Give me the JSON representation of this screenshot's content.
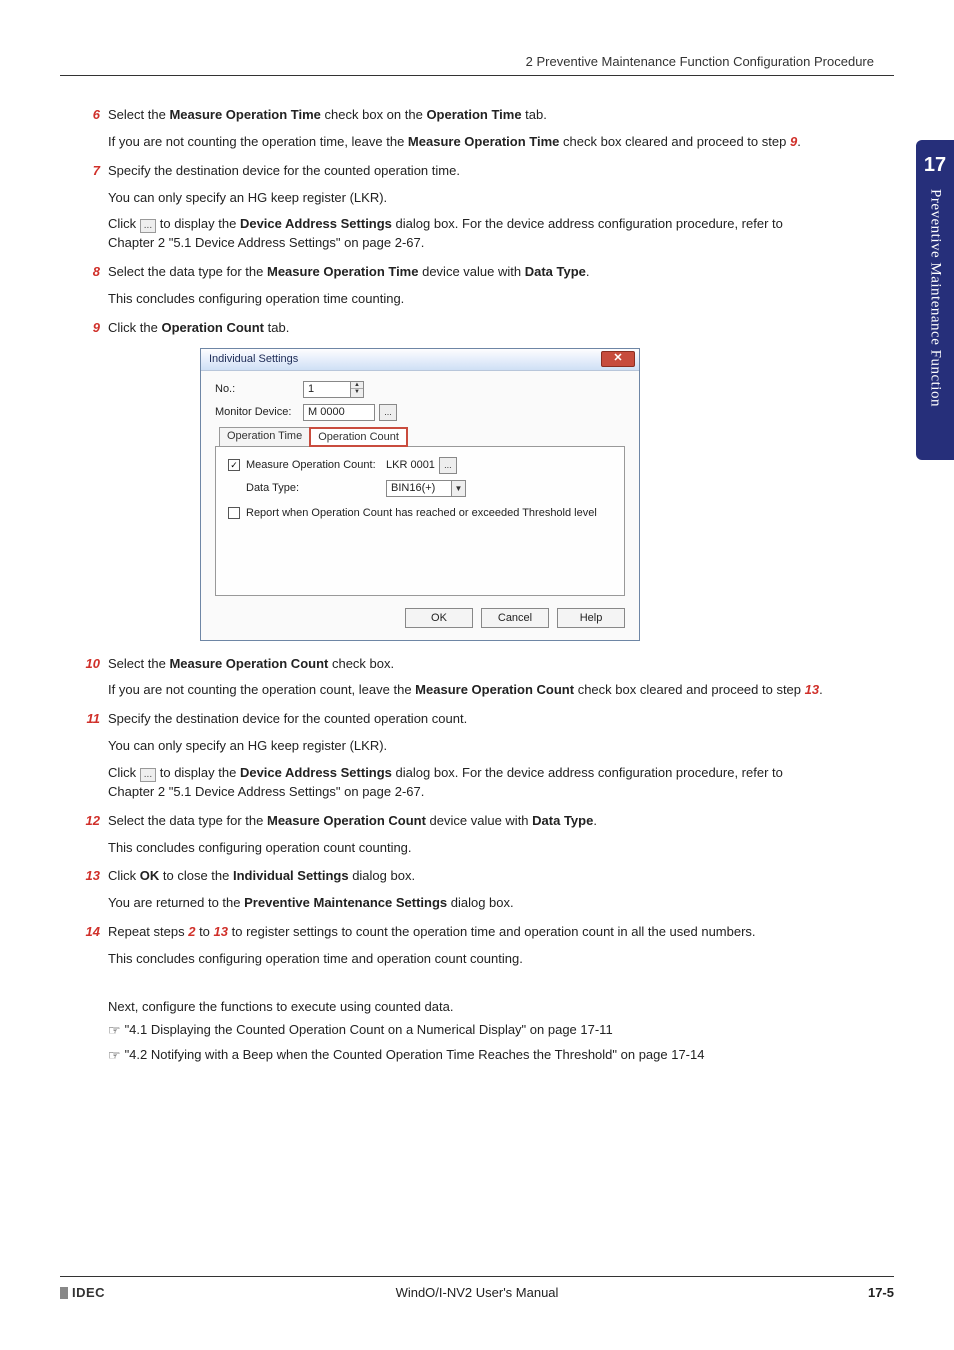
{
  "header": {
    "section": "2 Preventive Maintenance Function Configuration Procedure"
  },
  "sidetab": {
    "chapter_number": "17",
    "chapter_title": "Preventive Maintenance Function"
  },
  "dialog": {
    "title": "Individual Settings",
    "no_label": "No.:",
    "no_value": "1",
    "monitor_label": "Monitor Device:",
    "monitor_value": "M 0000",
    "tab_inactive": "Operation Time",
    "tab_active": "Operation Count",
    "chk1_label": "Measure Operation Count:",
    "chk1_value": "LKR 0001",
    "datatype_label": "Data Type:",
    "datatype_value": "BIN16(+)",
    "chk2_label": "Report when Operation Count has reached or exceeded Threshold level",
    "ok": "OK",
    "cancel": "Cancel",
    "help": "Help"
  },
  "steps": {
    "s6": {
      "num": "6",
      "p1a": "Select the ",
      "p1b": "Measure Operation Time",
      "p1c": " check box on the ",
      "p1d": "Operation Time",
      "p1e": " tab.",
      "p2a": "If you are not counting the operation time, leave the ",
      "p2b": "Measure Operation Time",
      "p2c": " check box cleared and proceed to step ",
      "p2d": "9",
      "p2e": "."
    },
    "s7": {
      "num": "7",
      "p1": "Specify the destination device for the counted operation time.",
      "p2": "You can only specify an HG keep register (LKR).",
      "p3a": "Click ",
      "p3btn": "...",
      "p3b": " to display the ",
      "p3c": "Device Address Settings",
      "p3d": " dialog box. For the device address configuration procedure, refer to Chapter 2 \"5.1 Device Address Settings\" on page 2-67."
    },
    "s8": {
      "num": "8",
      "p1a": "Select the data type for the ",
      "p1b": "Measure Operation Time",
      "p1c": " device value with ",
      "p1d": "Data Type",
      "p1e": ".",
      "p2": "This concludes configuring operation time counting."
    },
    "s9": {
      "num": "9",
      "p1a": "Click the ",
      "p1b": "Operation Count",
      "p1c": " tab."
    },
    "s10": {
      "num": "10",
      "p1a": "Select the ",
      "p1b": "Measure Operation Count",
      "p1c": " check box.",
      "p2a": "If you are not counting the operation count, leave the ",
      "p2b": "Measure Operation Count",
      "p2c": " check box cleared and proceed to step ",
      "p2d": "13",
      "p2e": "."
    },
    "s11": {
      "num": "11",
      "p1": "Specify the destination device for the counted operation count.",
      "p2": "You can only specify an HG keep register (LKR).",
      "p3a": "Click ",
      "p3btn": "...",
      "p3b": " to display the ",
      "p3c": "Device Address Settings",
      "p3d": " dialog box. For the device address configuration procedure, refer to Chapter 2 \"5.1 Device Address Settings\" on page 2-67."
    },
    "s12": {
      "num": "12",
      "p1a": "Select the data type for the ",
      "p1b": "Measure Operation Count",
      "p1c": " device value with ",
      "p1d": "Data Type",
      "p1e": ".",
      "p2": "This concludes configuring operation count counting."
    },
    "s13": {
      "num": "13",
      "p1a": "Click ",
      "p1b": "OK",
      "p1c": " to close the ",
      "p1d": "Individual Settings",
      "p1e": " dialog box.",
      "p2a": "You are returned to the ",
      "p2b": "Preventive Maintenance Settings",
      "p2c": " dialog box."
    },
    "s14": {
      "num": "14",
      "p1a": "Repeat steps ",
      "p1b": "2",
      "p1c": " to ",
      "p1d": "13",
      "p1e": " to register settings to count the operation time and operation count in all the used numbers.",
      "p2": "This concludes configuring operation time and operation count counting."
    }
  },
  "next": {
    "intro": "Next, configure the functions to execute using counted data.",
    "ref1": "\"4.1 Displaying the Counted Operation Count on a Numerical Display\" on page 17-11",
    "ref2": "\"4.2 Notifying with a Beep when the Counted Operation Time Reaches the Threshold\" on page 17-14"
  },
  "footer": {
    "brand": "IDEC",
    "manual": "WindO/I-NV2 User's Manual",
    "page": "17-5"
  }
}
